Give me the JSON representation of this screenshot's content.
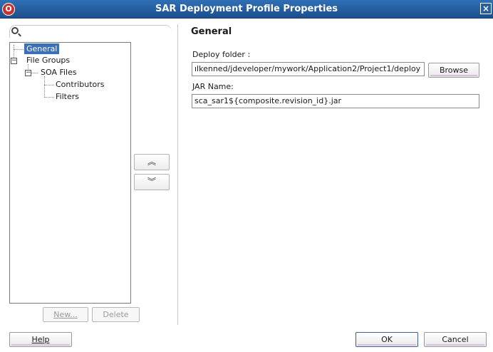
{
  "window": {
    "title": "SAR Deployment Profile Properties",
    "app_icon_glyph": "O",
    "close_glyph": "×"
  },
  "tree": {
    "items": [
      {
        "label": "General",
        "selected": true
      },
      {
        "label": "File Groups",
        "expander": "−"
      },
      {
        "label": "SOA Files",
        "expander": "−"
      },
      {
        "label": "Contributors"
      },
      {
        "label": "Filters"
      }
    ]
  },
  "move_buttons": {
    "up": "︽",
    "down": "︾"
  },
  "tree_actions": {
    "new_label": "New...",
    "delete_label": "Delete"
  },
  "panel": {
    "title": "General",
    "deploy_folder_label": "Deploy folder :",
    "deploy_folder_value": "ılkenned/jdeveloper/mywork/Application2/Project1/deploy",
    "browse_label": "Browse",
    "jar_name_label": "JAR Name:",
    "jar_name_value": "sca_sar1${composite.revision_id}.jar"
  },
  "footer": {
    "help_label": "Help",
    "ok_label": "OK",
    "cancel_label": "Cancel"
  },
  "colors": {
    "titlebar": "#2f6fb5",
    "selection": "#3b6fb6",
    "button_underline": "#d7bfe0"
  }
}
